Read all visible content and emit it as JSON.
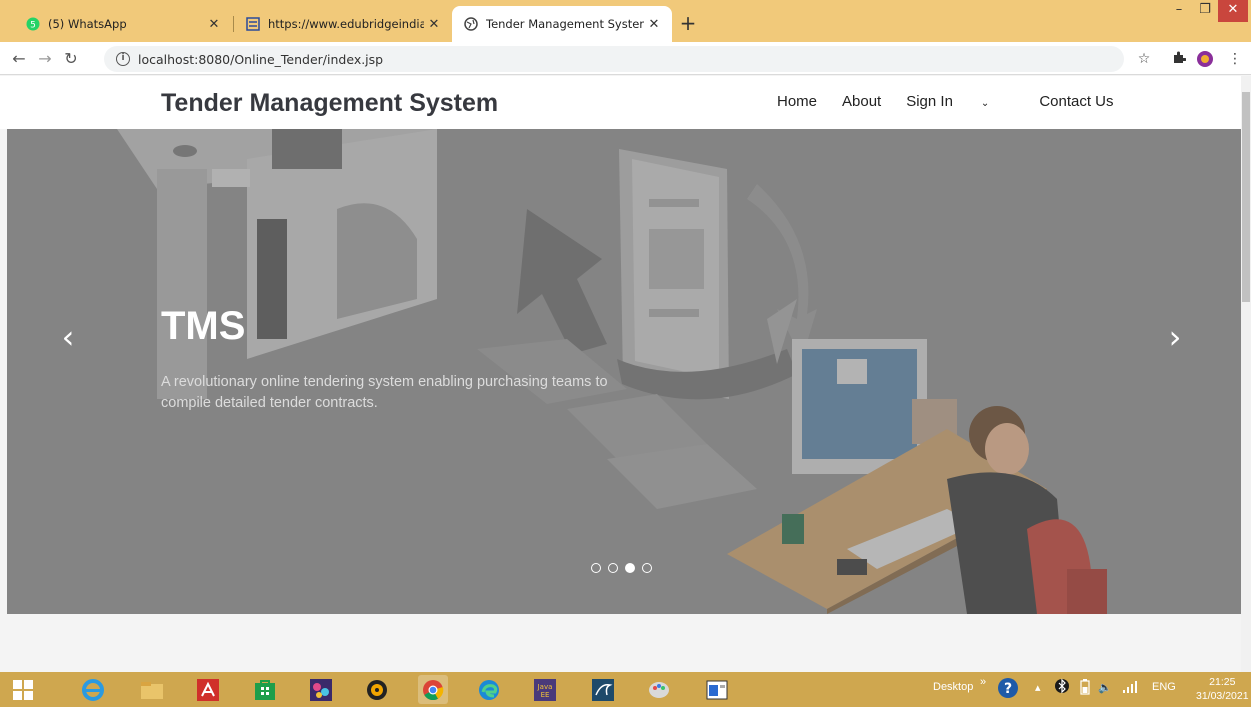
{
  "browser": {
    "tabs": [
      {
        "title": "(5) WhatsApp",
        "icon": "whatsapp-icon",
        "active": false
      },
      {
        "title": "https://www.edubridgeindia.com",
        "icon": "edubridge-icon",
        "active": false
      },
      {
        "title": "Tender Management System",
        "icon": "globe-icon",
        "active": true
      }
    ],
    "new_tab": "+",
    "url": "localhost:8080/Online_Tender/index.jsp"
  },
  "site": {
    "brand": "Tender Management System",
    "nav": {
      "home": "Home",
      "about": "About",
      "sign_in": "Sign In",
      "contact": "Contact Us"
    },
    "carousel": {
      "title": "TMS",
      "text": "A revolutionary online tendering system enabling purchasing teams to compile detailed tender contracts.",
      "prev": "‹",
      "next": "›",
      "slide_count": 4,
      "active_slide": 3
    }
  },
  "taskbar": {
    "desktop_label": "Desktop",
    "language": "ENG",
    "time": "21:25",
    "date": "31/03/2021"
  },
  "colors": {
    "tabstrip": "#f1c97a",
    "taskbar": "#cfa74f",
    "hero_overlay": "#8f8f8f"
  }
}
